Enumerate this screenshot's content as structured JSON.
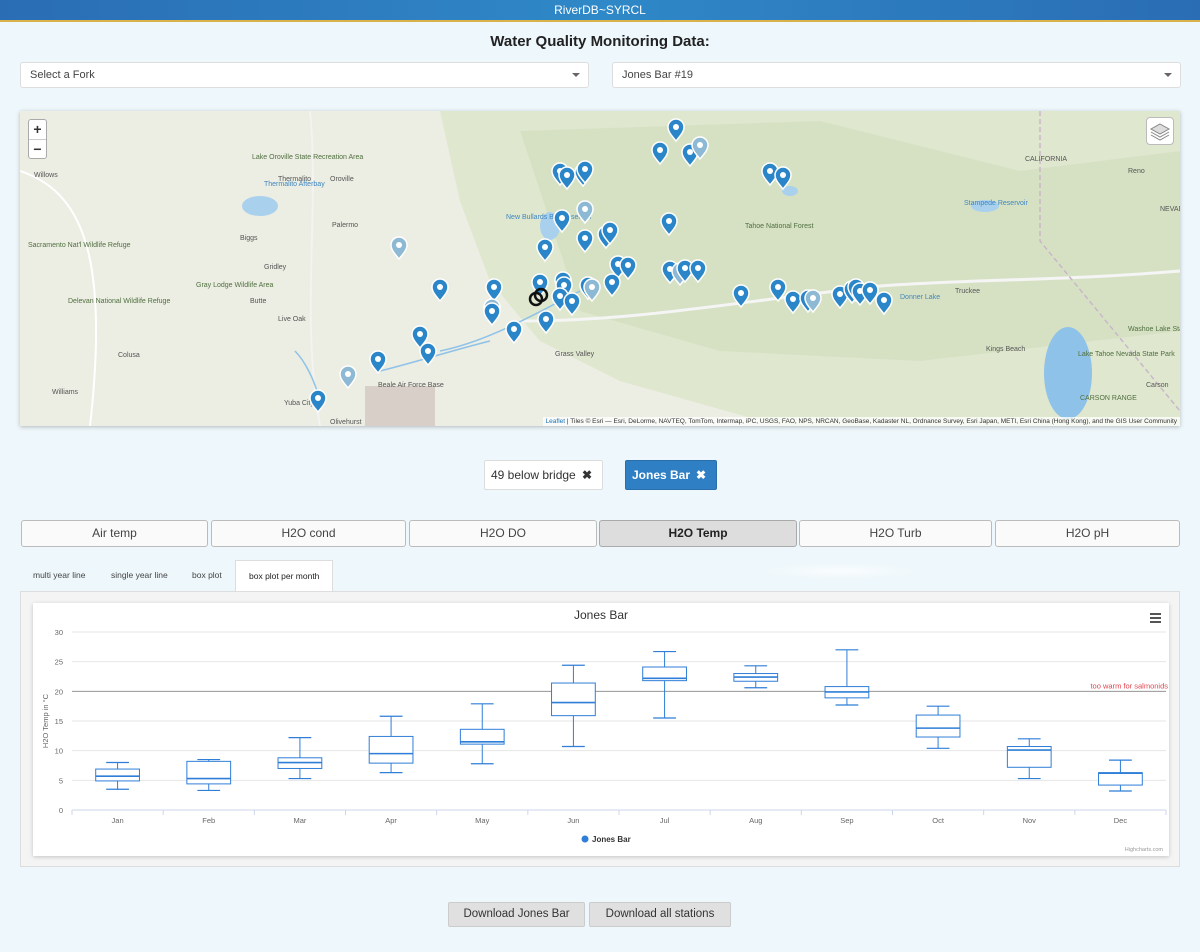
{
  "app": {
    "title": "RiverDB~SYRCL"
  },
  "page": {
    "title": "Water Quality Monitoring Data:"
  },
  "selectors": {
    "fork": {
      "value": "Select a Fork"
    },
    "station": {
      "value": "Jones Bar #19"
    }
  },
  "map": {
    "zoom_in": "+",
    "zoom_out": "−",
    "attribution_link": "Leaflet",
    "attribution_text": " | Tiles © Esri — Esri, DeLorme, NAVTEQ, TomTom, Intermap, iPC, USGS, FAO, NPS, NRCAN, GeoBase, Kadaster NL, Ordnance Survey, Esri Japan, METI, Esri China (Hong Kong), and the GIS User Community",
    "labels": [
      {
        "text": "Willows",
        "cls": "town"
      },
      {
        "text": "Thermalito",
        "cls": "town"
      },
      {
        "text": "Oroville",
        "cls": "town"
      },
      {
        "text": "Lake Oroville State Recreation Area",
        "cls": "park"
      },
      {
        "text": "Thermalito Afterbay",
        "cls": "water"
      },
      {
        "text": "Palermo",
        "cls": "town"
      },
      {
        "text": "Biggs",
        "cls": "town"
      },
      {
        "text": "Gridley",
        "cls": "town"
      },
      {
        "text": "Sacramento Nat'l Wildlife Refuge",
        "cls": "park"
      },
      {
        "text": "Gray Lodge Wildlife Area",
        "cls": "park"
      },
      {
        "text": "Delevan National Wildlife Refuge",
        "cls": "park"
      },
      {
        "text": "Butte",
        "cls": "town"
      },
      {
        "text": "Live Oak",
        "cls": "town"
      },
      {
        "text": "Colusa",
        "cls": "town"
      },
      {
        "text": "Williams",
        "cls": "town"
      },
      {
        "text": "Yuba City",
        "cls": "town"
      },
      {
        "text": "Olivehurst",
        "cls": "town"
      },
      {
        "text": "Beale Air Force Base",
        "cls": "town"
      },
      {
        "text": "Grass Valley",
        "cls": "town"
      },
      {
        "text": "New Bullards Bar Reservoir",
        "cls": "water"
      },
      {
        "text": "Tahoe National Forest",
        "cls": "park"
      },
      {
        "text": "Truckee",
        "cls": "town"
      },
      {
        "text": "Kings Beach",
        "cls": "town"
      },
      {
        "text": "Reno",
        "cls": "town"
      },
      {
        "text": "Stampede Reservoir",
        "cls": "water"
      },
      {
        "text": "Washoe Lake State Park",
        "cls": "park"
      },
      {
        "text": "Lake Tahoe Nevada State Park",
        "cls": "park"
      },
      {
        "text": "Carson",
        "cls": "town"
      },
      {
        "text": "CARSON RANGE",
        "cls": "park"
      },
      {
        "text": "Donner Lake",
        "cls": "water"
      },
      {
        "text": "CALIFORNIA",
        "cls": "town"
      },
      {
        "text": "NEVADA",
        "cls": "town"
      }
    ]
  },
  "station_chips": [
    {
      "label": "49 below bridge",
      "close": "✖"
    },
    {
      "label": "Jones Bar",
      "close": "✖"
    }
  ],
  "param_tabs": [
    "Air temp",
    "H2O cond",
    "H2O DO",
    "H2O Temp",
    "H2O Turb",
    "H2O pH"
  ],
  "active_param": "H2O Temp",
  "chart_tabs": [
    "multi year line",
    "single year line",
    "box plot",
    "box plot per month"
  ],
  "active_chart_tab": "box plot per month",
  "chart_data": {
    "type": "boxplot",
    "title": "Jones Bar",
    "ylabel": "H2O Temp in °C",
    "xlabel": "",
    "ylim": [
      0,
      30
    ],
    "yticks": [
      0,
      5,
      10,
      15,
      20,
      25,
      30
    ],
    "grid": true,
    "legend_position": "bottom-center",
    "categories": [
      "Jan",
      "Feb",
      "Mar",
      "Apr",
      "May",
      "Jun",
      "Jul",
      "Aug",
      "Sep",
      "Oct",
      "Nov",
      "Dec"
    ],
    "series": [
      {
        "name": "Jones Bar",
        "color": "#2f7ed8",
        "boxes": [
          {
            "low": 3.5,
            "q1": 4.9,
            "median": 5.7,
            "q3": 6.9,
            "high": 8.0
          },
          {
            "low": 3.3,
            "q1": 4.4,
            "median": 5.3,
            "q3": 8.2,
            "high": 8.5
          },
          {
            "low": 5.3,
            "q1": 7.0,
            "median": 8.0,
            "q3": 8.8,
            "high": 12.2
          },
          {
            "low": 6.3,
            "q1": 7.9,
            "median": 9.5,
            "q3": 12.4,
            "high": 15.8
          },
          {
            "low": 7.8,
            "q1": 11.1,
            "median": 11.5,
            "q3": 13.6,
            "high": 17.9
          },
          {
            "low": 10.7,
            "q1": 15.9,
            "median": 18.1,
            "q3": 21.4,
            "high": 24.4
          },
          {
            "low": 15.5,
            "q1": 21.8,
            "median": 22.2,
            "q3": 24.1,
            "high": 26.7
          },
          {
            "low": 20.6,
            "q1": 21.7,
            "median": 22.4,
            "q3": 23.0,
            "high": 24.3
          },
          {
            "low": 17.7,
            "q1": 18.9,
            "median": 19.9,
            "q3": 20.8,
            "high": 27.0
          },
          {
            "low": 10.4,
            "q1": 12.3,
            "median": 13.8,
            "q3": 16.0,
            "high": 17.5
          },
          {
            "low": 5.3,
            "q1": 7.2,
            "median": 10.1,
            "q3": 10.7,
            "high": 12.0
          },
          {
            "low": 3.2,
            "q1": 4.2,
            "median": 6.2,
            "q3": 6.3,
            "high": 8.4
          }
        ]
      }
    ],
    "plot_lines": [
      {
        "value": 20,
        "label": "too warm for salmonids",
        "label_color": "#e0454f"
      }
    ],
    "credits": "Highcharts.com"
  },
  "downloads": {
    "station_button": "Download Jones Bar",
    "all_button": "Download all stations"
  },
  "colors": {
    "accent": "#2f7fc4",
    "marker": "#2a86c8",
    "grid": "#e6e6e6"
  }
}
